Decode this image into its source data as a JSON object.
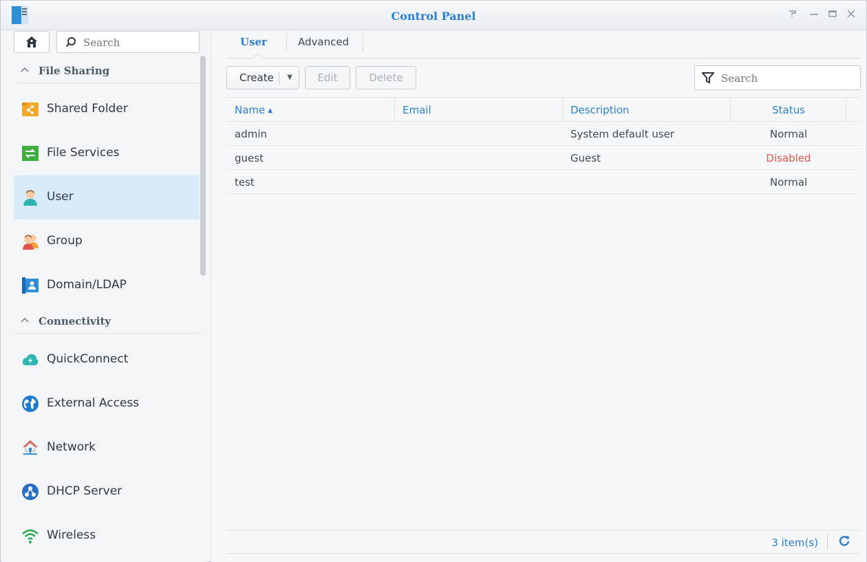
{
  "window": {
    "title": "Control Panel",
    "controls": [
      "help-icon",
      "minimize-icon",
      "maximize-icon",
      "close-icon"
    ]
  },
  "sidebar": {
    "search_placeholder": "Search",
    "sections": [
      {
        "title": "File Sharing",
        "items": [
          {
            "label": "Shared Folder",
            "icon": "shared-folder-icon"
          },
          {
            "label": "File Services",
            "icon": "file-services-icon"
          },
          {
            "label": "User",
            "icon": "user-icon",
            "active": true
          },
          {
            "label": "Group",
            "icon": "group-icon"
          },
          {
            "label": "Domain/LDAP",
            "icon": "domain-ldap-icon"
          }
        ]
      },
      {
        "title": "Connectivity",
        "items": [
          {
            "label": "QuickConnect",
            "icon": "quickconnect-icon"
          },
          {
            "label": "External Access",
            "icon": "external-access-icon"
          },
          {
            "label": "Network",
            "icon": "network-icon"
          },
          {
            "label": "DHCP Server",
            "icon": "dhcp-server-icon"
          },
          {
            "label": "Wireless",
            "icon": "wireless-icon"
          }
        ]
      }
    ]
  },
  "main": {
    "tabs": [
      {
        "label": "User",
        "active": true
      },
      {
        "label": "Advanced"
      }
    ],
    "toolbar": {
      "create_label": "Create",
      "edit_label": "Edit",
      "delete_label": "Delete",
      "filter_placeholder": "Search"
    },
    "table": {
      "columns": [
        "Name",
        "Email",
        "Description",
        "Status"
      ],
      "rows": [
        {
          "name": "admin",
          "email": "",
          "description": "System default user",
          "status": "Normal"
        },
        {
          "name": "guest",
          "email": "",
          "description": "Guest",
          "status": "Disabled"
        },
        {
          "name": "test",
          "email": "",
          "description": "",
          "status": "Normal"
        }
      ]
    },
    "footer": {
      "count": "3 item(s)"
    }
  },
  "colors": {
    "accent": "#2a7fd4",
    "disabled_status": "#e2534b",
    "active_item_bg": "#d8e9f8"
  }
}
